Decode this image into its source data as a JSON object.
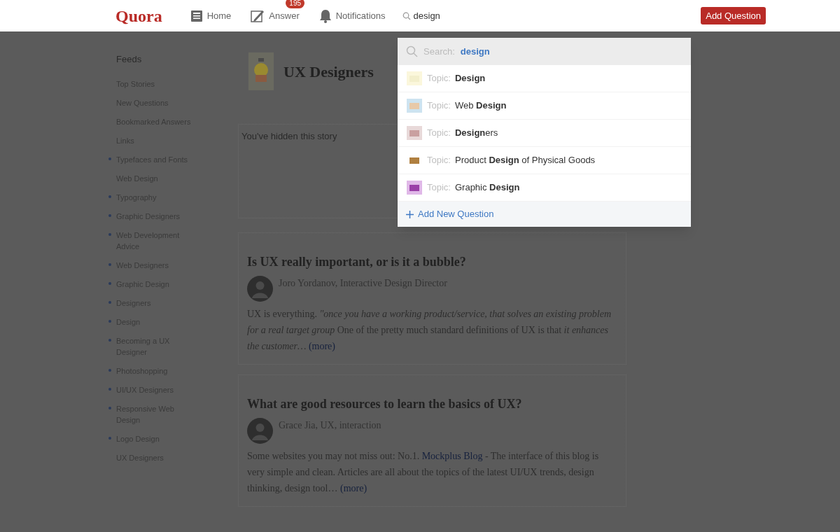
{
  "nav": {
    "logo": "Quora",
    "items": [
      {
        "kind": "home",
        "label": "Home"
      },
      {
        "kind": "answer",
        "label": "Answer",
        "badge": "195"
      },
      {
        "kind": "notifications",
        "label": "Notifications"
      }
    ],
    "search": {
      "value": "design"
    },
    "add_button": "Add Question"
  },
  "sidebar": {
    "title": "Feeds",
    "items": [
      {
        "label": "Top Stories",
        "dot": false
      },
      {
        "label": "New Questions",
        "dot": false
      },
      {
        "label": "Bookmarked Answers",
        "dot": false
      },
      {
        "label": "Links",
        "dot": false
      },
      {
        "label": "Typefaces and Fonts",
        "dot": true
      },
      {
        "label": "Web Design",
        "dot": false
      },
      {
        "label": "Typography",
        "dot": true
      },
      {
        "label": "Graphic Designers",
        "dot": true
      },
      {
        "label": "Web Development Advice",
        "dot": true
      },
      {
        "label": "Web Designers",
        "dot": true
      },
      {
        "label": "Graphic Design",
        "dot": true
      },
      {
        "label": "Designers",
        "dot": true
      },
      {
        "label": "Design",
        "dot": true
      },
      {
        "label": "Becoming a UX Designer",
        "dot": true
      },
      {
        "label": "Photoshopping",
        "dot": true
      },
      {
        "label": "UI/UX Designers",
        "dot": true
      },
      {
        "label": "Responsive Web Design",
        "dot": true
      },
      {
        "label": "Logo Design",
        "dot": true
      },
      {
        "label": "UX Designers",
        "dot": false
      }
    ]
  },
  "feed": {
    "title": "UX Designers",
    "hidden_notice": "You've hidden this story",
    "stories": [
      {
        "title": "Is UX really important, or is it a bubble?",
        "author": "Joro Yordanov, Interactive Design Director",
        "parts": [
          {
            "kind": "text",
            "text": "UX is everything. *\"once you have a working product/service, that solves an existing problem for a real target group* One of the pretty much standard definitions of UX is that *it enhances the customer…* "
          },
          {
            "kind": "link",
            "text": "(more)"
          }
        ]
      },
      {
        "title": "What are good resources to learn the basics of UX?",
        "author": "Grace Jia, UX, interaction",
        "parts": [
          {
            "kind": "text",
            "text": "Some websites you may not miss out: No.1. "
          },
          {
            "kind": "link",
            "text": "Mockplus Blog"
          },
          {
            "kind": "text",
            "text": " - The interface of this blog is very simple and clean. Articles are all about the topics of the latest UI/UX trends, design thinking, design tool… "
          },
          {
            "kind": "link",
            "text": "(more)"
          }
        ]
      }
    ]
  },
  "dropdown": {
    "search_label": "Search:",
    "query": "design",
    "results": [
      {
        "prefix": "Topic:",
        "label": "**Design**"
      },
      {
        "prefix": "Topic:",
        "label": "Web **Design**"
      },
      {
        "prefix": "Topic:",
        "label": "**Design**ers"
      },
      {
        "prefix": "Topic:",
        "label": "Product **Design** of Physical Goods"
      },
      {
        "prefix": "Topic:",
        "label": "Graphic **Design**"
      }
    ],
    "add": "Add New Question"
  }
}
